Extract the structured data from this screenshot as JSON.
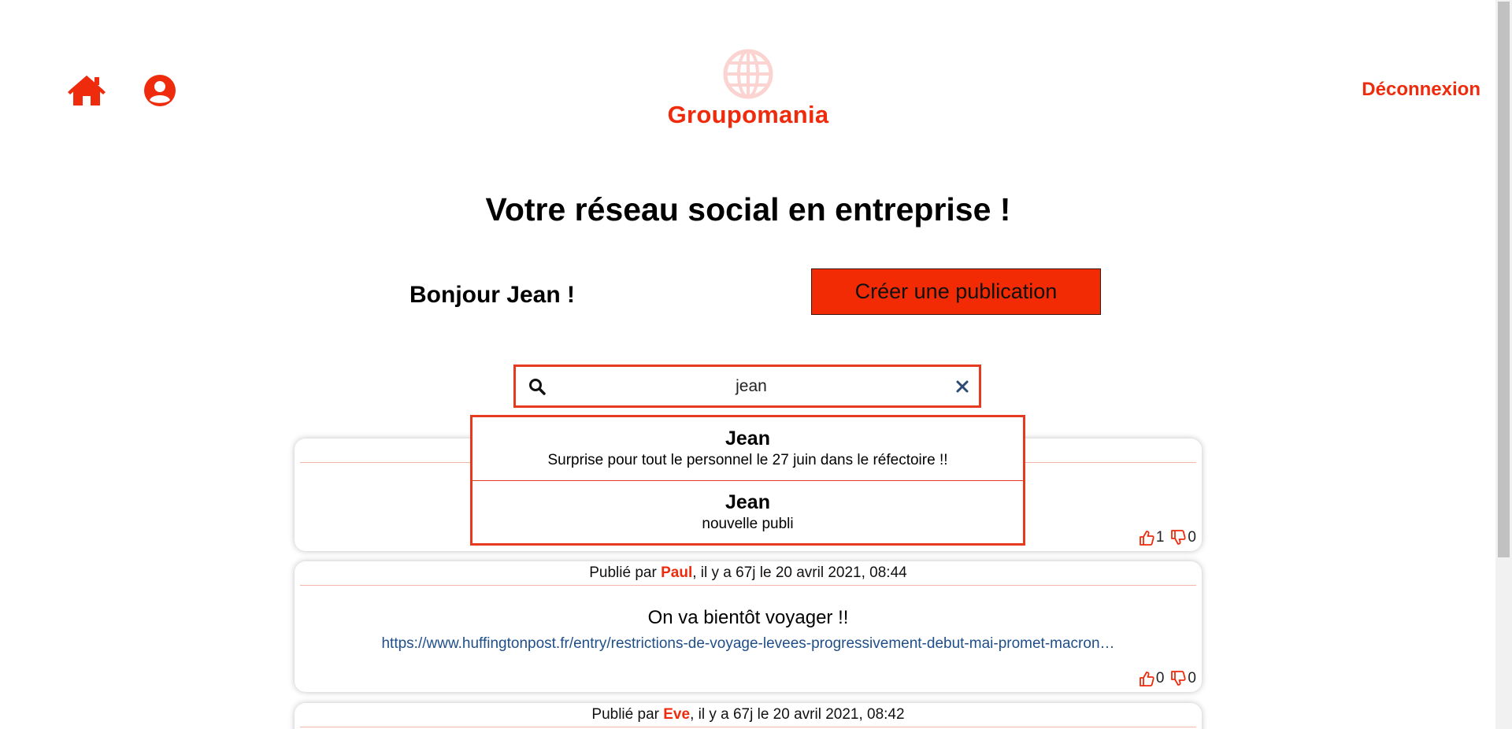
{
  "header": {
    "brand": "Groupomania",
    "logout_label": "Déconnexion"
  },
  "main": {
    "title": "Votre réseau social en entreprise !",
    "greeting": "Bonjour Jean !",
    "create_label": "Créer une publication"
  },
  "search": {
    "value": "jean",
    "results": [
      {
        "author": "Jean",
        "text": "Surprise pour tout le personnel le 27 juin dans le réfectoire !!"
      },
      {
        "author": "Jean",
        "text": "nouvelle publi"
      }
    ]
  },
  "posts": [
    {
      "likes": "1",
      "dislikes": "0"
    },
    {
      "prefix": "Publié par ",
      "author": "Paul",
      "suffix": ", il y a 67j le 20 avril 2021, 08:44",
      "text": "On va bientôt voyager !!",
      "link": "https://www.huffingtonpost.fr/entry/restrictions-de-voyage-levees-progressivement-debut-mai-promet-macron…",
      "likes": "0",
      "dislikes": "0"
    },
    {
      "prefix": "Publié par ",
      "author": "Eve",
      "suffix": ", il y a 67j le 20 avril 2021, 08:42"
    }
  ],
  "colors": {
    "accent": "#ee2b0c",
    "link": "#1f4f8a",
    "logo_globe": "#fbd3d0"
  }
}
